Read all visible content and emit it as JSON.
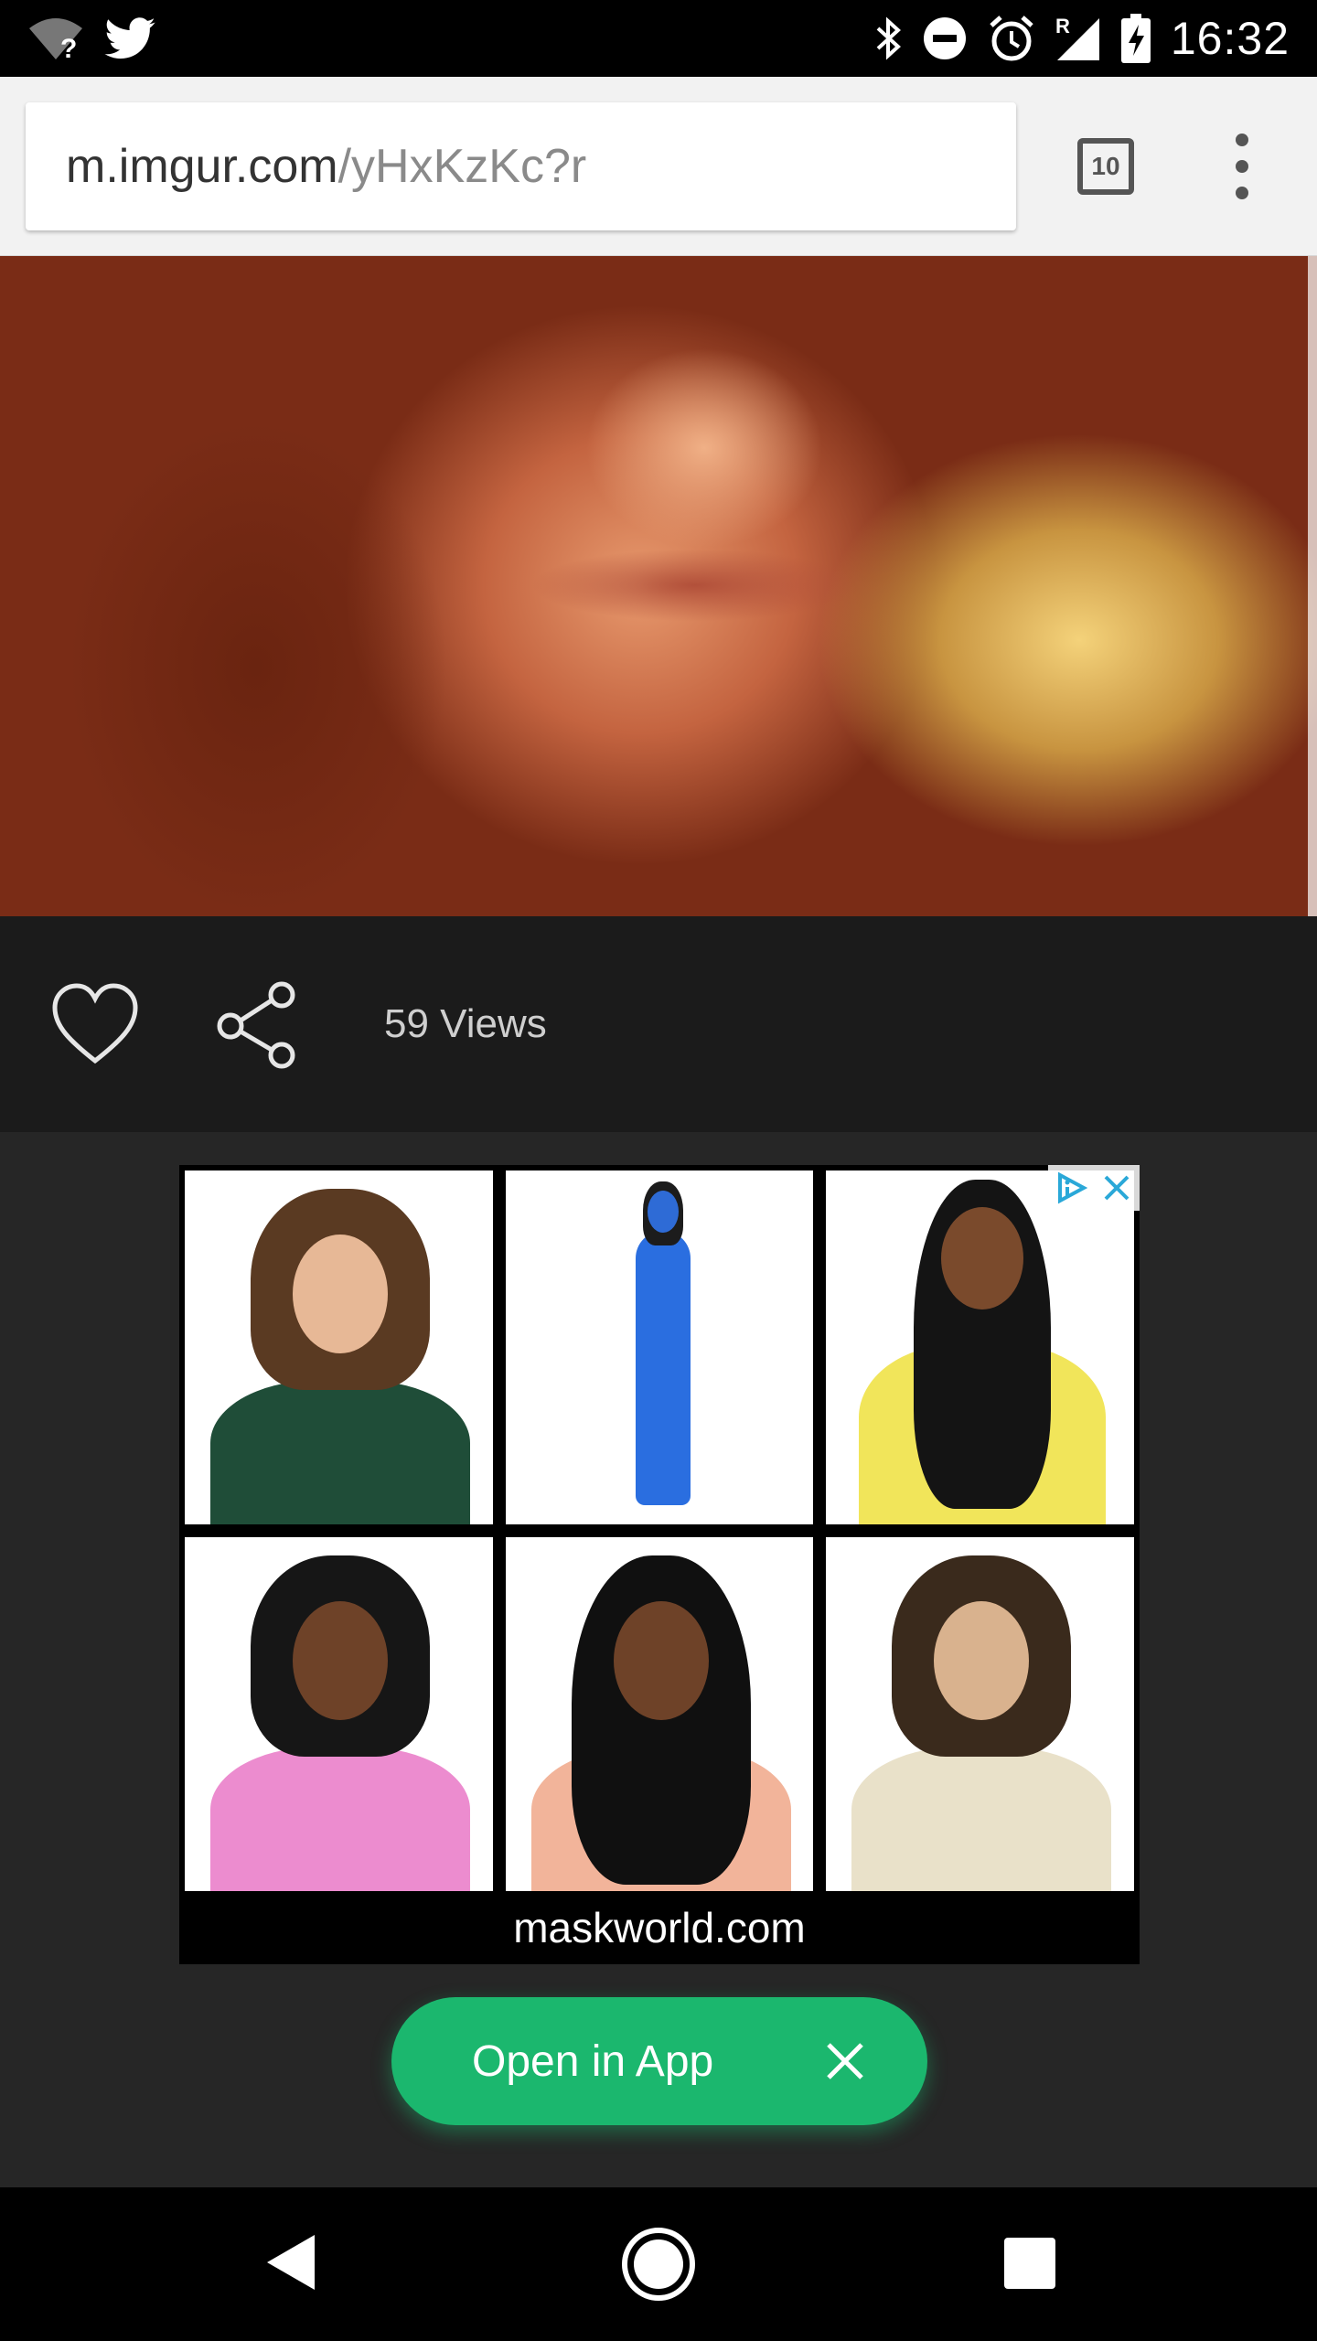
{
  "status_bar": {
    "time": "16:32",
    "icons": [
      "wifi-unknown-icon",
      "twitter-icon",
      "bluetooth-icon",
      "do-not-disturb-icon",
      "alarm-icon",
      "signal-roaming-icon",
      "battery-charging-icon"
    ],
    "roaming_indicator": "R",
    "wifi_unknown_mark": "?"
  },
  "browser": {
    "url_host": "m.imgur.com",
    "url_path": "/yHxKzKc?r",
    "tab_count": "10",
    "menu_icon": "overflow-menu-icon"
  },
  "post": {
    "views_text": "59 Views",
    "like_icon": "heart-icon",
    "share_icon": "share-icon"
  },
  "ad": {
    "domain": "maskworld.com",
    "adchoices_icon": "adchoices-icon",
    "close_icon": "close-icon",
    "tiles": [
      {
        "name": "ad-tile-dreadlock-wig-green-jacket",
        "hair": "#5a3a22",
        "skin": "#e7b896",
        "shirt": "#1f4d38"
      },
      {
        "name": "ad-tile-blue-alien-costume",
        "hair": "#1c1c1c",
        "skin": "#2e6bd6",
        "shirt": "#2a6ee0"
      },
      {
        "name": "ad-tile-long-braids-wig-yellow-shirt",
        "hair": "#141414",
        "skin": "#7a4a2c",
        "shirt": "#f1e55a"
      },
      {
        "name": "ad-tile-short-dreads-pink-shirt",
        "hair": "#161616",
        "skin": "#6e4228",
        "shirt": "#ec8ccf"
      },
      {
        "name": "ad-tile-long-dreads-peach-shirt",
        "hair": "#101010",
        "skin": "#6e4228",
        "shirt": "#f2b49a"
      },
      {
        "name": "ad-tile-jesus-wig-beard",
        "hair": "#3a2a1c",
        "skin": "#d9b28e",
        "shirt": "#e9e1c9"
      }
    ]
  },
  "open_app": {
    "label": "Open in App",
    "close_icon": "close-icon",
    "color": "#1bb76e"
  },
  "nav_bar": {
    "icons": [
      "back-icon",
      "home-icon",
      "recents-icon"
    ]
  }
}
